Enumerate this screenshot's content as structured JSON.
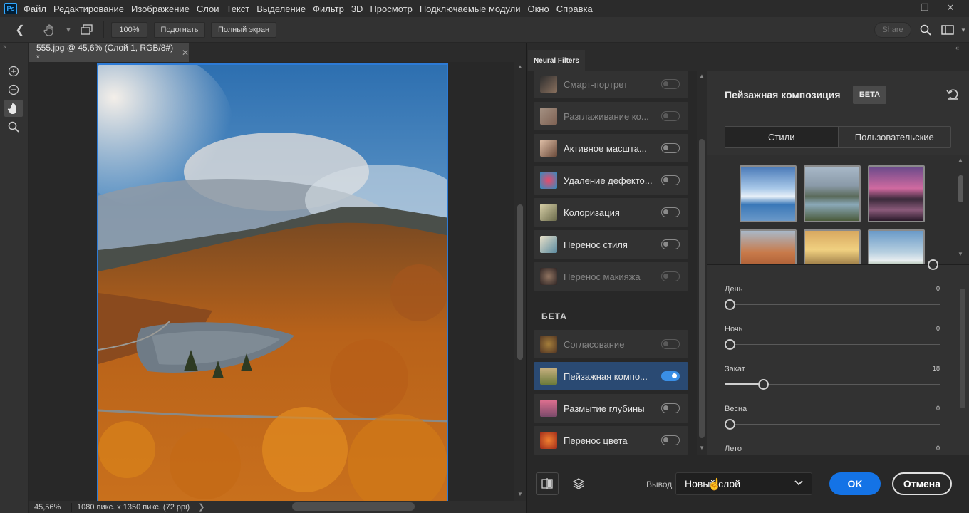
{
  "menu": {
    "app_icon": "Ps",
    "items": [
      "Файл",
      "Редактирование",
      "Изображение",
      "Слои",
      "Текст",
      "Выделение",
      "Фильтр",
      "3D",
      "Просмотр",
      "Подключаемые модули",
      "Окно",
      "Справка"
    ]
  },
  "window_controls": [
    "minimize-icon",
    "restore-icon",
    "close-icon"
  ],
  "options_bar": {
    "zoom_100": "100%",
    "fit_screen": "Подогнать",
    "full_screen": "Полный экран",
    "share": "Share"
  },
  "document": {
    "tab_title": "555.jpg @ 45,6% (Слой 1, RGB/8#) *",
    "zoom": "45,56%",
    "info": "1080 пикс. x 1350 пикс. (72 ppi)"
  },
  "neural_filters": {
    "panel_title": "Neural Filters",
    "filters": [
      {
        "label": "Смарт-портрет",
        "disabled": true,
        "on": false,
        "thumb_color": "#c49a7c"
      },
      {
        "label": "Разглаживание ко...",
        "disabled": true,
        "on": false,
        "thumb_color": "#e0b89c"
      },
      {
        "label": "Активное масшта...",
        "disabled": false,
        "on": false,
        "thumb_color": "#b08a6a"
      },
      {
        "label": "Удаление дефекто...",
        "disabled": false,
        "on": false,
        "thumb_color": "#3a8fc4"
      },
      {
        "label": "Колоризация",
        "disabled": false,
        "on": false,
        "thumb_color": "#a3a37a"
      },
      {
        "label": "Перенос стиля",
        "disabled": false,
        "on": false,
        "thumb_color": "#7aa0b0"
      },
      {
        "label": "Перенос макияжа",
        "disabled": true,
        "on": false,
        "thumb_color": "#8a6a5a"
      }
    ],
    "beta_heading": "БЕТА",
    "beta_filters": [
      {
        "label": "Согласование",
        "disabled": true,
        "on": false,
        "thumb_color": "#c8962a"
      },
      {
        "label": "Пейзажная компо...",
        "disabled": false,
        "on": true,
        "selected": true,
        "thumb_color": "#a89060"
      },
      {
        "label": "Размытие глубины",
        "disabled": false,
        "on": false,
        "thumb_color": "#c06080"
      },
      {
        "label": "Перенос цвета",
        "disabled": false,
        "on": false,
        "thumb_color": "#d04a2a"
      }
    ]
  },
  "settings": {
    "title": "Пейзажная композиция",
    "badge": "БЕТА",
    "tabs": [
      "Стили",
      "Пользовательские"
    ],
    "active_tab": "Стили",
    "sliders": [
      {
        "label": "День",
        "value": 0,
        "fraction": 0
      },
      {
        "label": "Ночь",
        "value": 0,
        "fraction": 0
      },
      {
        "label": "Закат",
        "value": 18,
        "fraction": 0.18
      },
      {
        "label": "Весна",
        "value": 0,
        "fraction": 0
      },
      {
        "label": "Лето",
        "value": 0,
        "fraction": 0
      }
    ]
  },
  "footer": {
    "output_label": "Вывод",
    "output_value": "Новый слой",
    "ok": "OK",
    "cancel": "Отмена"
  }
}
